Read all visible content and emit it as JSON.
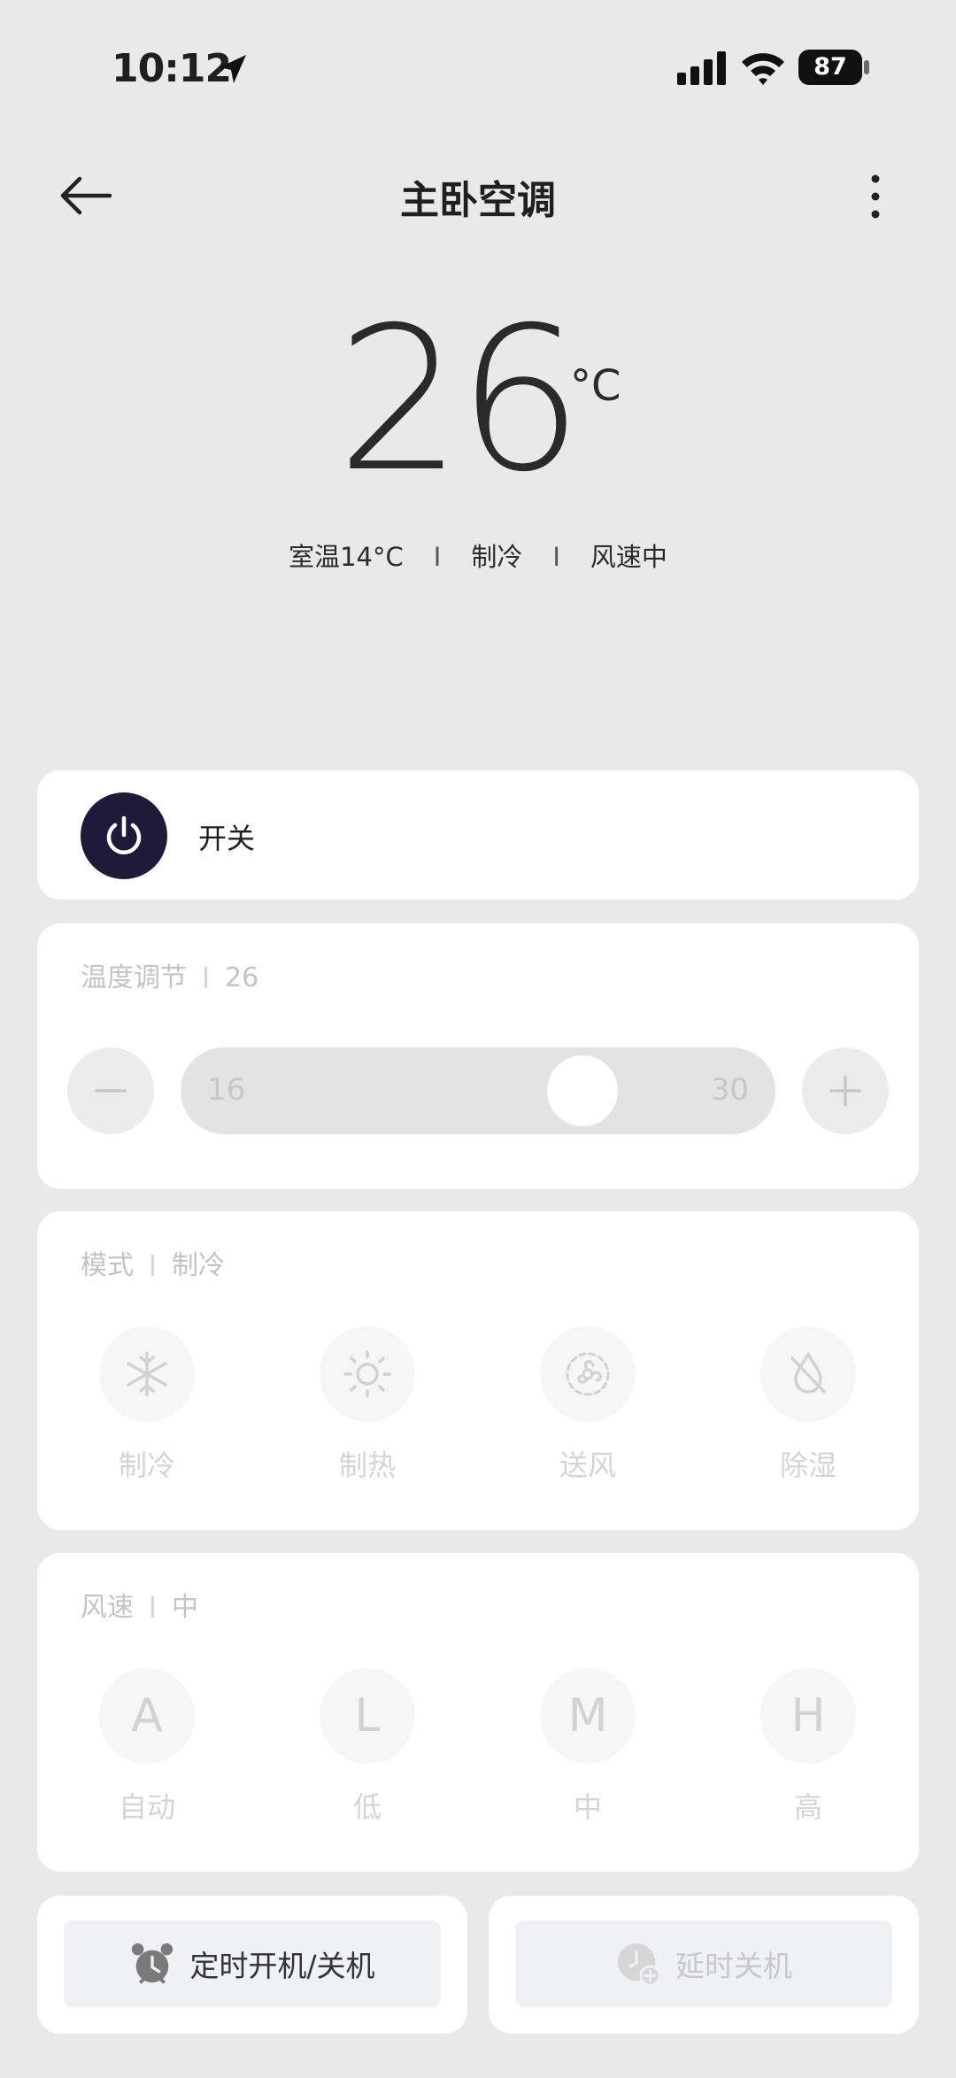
{
  "status_bar": {
    "time": "10:12",
    "battery": "87"
  },
  "header": {
    "title": "主卧空调"
  },
  "display": {
    "set_temp": "26",
    "unit": "°C",
    "room_temp": "室温14°C",
    "mode": "制冷",
    "fan": "风速中"
  },
  "power": {
    "label": "开关"
  },
  "temperature": {
    "heading": "温度调节",
    "value": "26",
    "min": "16",
    "max": "30",
    "current": 26
  },
  "mode": {
    "heading": "模式",
    "value": "制冷",
    "options": [
      {
        "label": "制冷",
        "icon": "snowflake-icon"
      },
      {
        "label": "制热",
        "icon": "sun-icon"
      },
      {
        "label": "送风",
        "icon": "fan-icon"
      },
      {
        "label": "除湿",
        "icon": "dehumidify-icon"
      }
    ]
  },
  "fan": {
    "heading": "风速",
    "value": "中",
    "options": [
      {
        "glyph": "A",
        "label": "自动"
      },
      {
        "glyph": "L",
        "label": "低"
      },
      {
        "glyph": "M",
        "label": "中"
      },
      {
        "glyph": "H",
        "label": "高"
      }
    ]
  },
  "schedule": {
    "timer_label": "定时开机/关机",
    "delay_label": "延时关机"
  },
  "colors": {
    "accent": "#1f1a3a",
    "background": "#e9e9ea"
  }
}
